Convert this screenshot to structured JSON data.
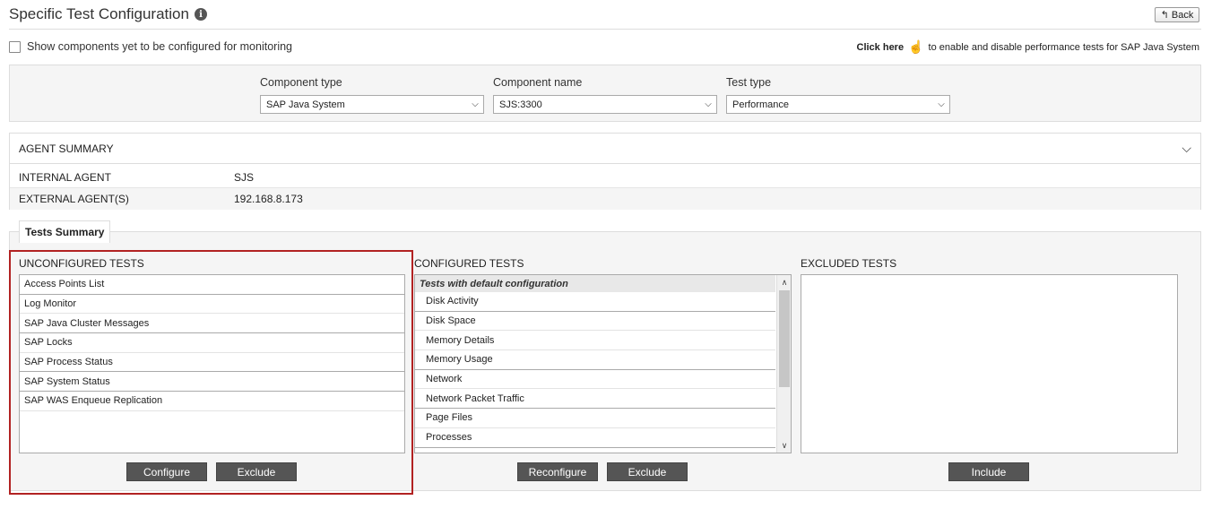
{
  "page": {
    "title": "Specific Test Configuration",
    "back_label": "Back"
  },
  "options": {
    "show_unconfigured_label": "Show components yet to be configured for monitoring",
    "click_here_label": "Click here",
    "click_here_suffix": "to enable and disable performance tests for SAP Java System"
  },
  "filters": {
    "component_type": {
      "label": "Component type",
      "value": "SAP Java System"
    },
    "component_name": {
      "label": "Component name",
      "value": "SJS:3300"
    },
    "test_type": {
      "label": "Test type",
      "value": "Performance"
    }
  },
  "agent_summary": {
    "title": "AGENT SUMMARY",
    "internal_label": "INTERNAL AGENT",
    "internal_value": "SJS",
    "external_label": "EXTERNAL AGENT(S)",
    "external_value": "192.168.8.173"
  },
  "tests_summary": {
    "legend": "Tests Summary",
    "unconfigured": {
      "title": "UNCONFIGURED TESTS",
      "items": [
        "Access Points List",
        "Log Monitor",
        "SAP Java Cluster Messages",
        "SAP Locks",
        "SAP Process Status",
        "SAP System Status",
        "SAP WAS Enqueue Replication"
      ],
      "configure_label": "Configure",
      "exclude_label": "Exclude"
    },
    "configured": {
      "title": "CONFIGURED TESTS",
      "group_header": "Tests with default configuration",
      "items": [
        "Disk Activity",
        "Disk Space",
        "Memory Details",
        "Memory Usage",
        "Network",
        "Network Packet Traffic",
        "Page Files",
        "Processes"
      ],
      "reconfigure_label": "Reconfigure",
      "exclude_label": "Exclude"
    },
    "excluded": {
      "title": "EXCLUDED TESTS",
      "items": [],
      "include_label": "Include"
    }
  }
}
